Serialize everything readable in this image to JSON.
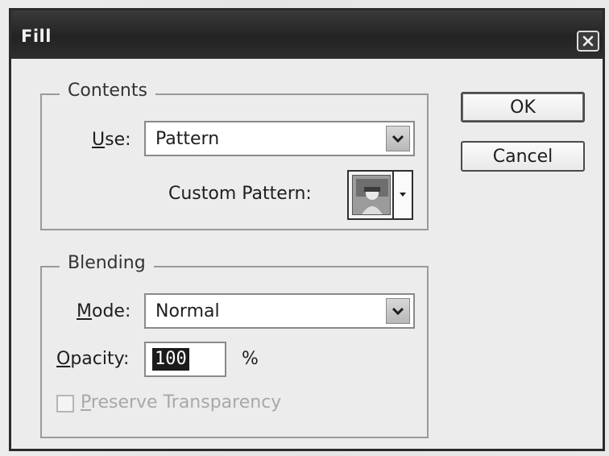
{
  "window": {
    "title": "Fill",
    "close_icon": "close-icon"
  },
  "contents": {
    "label": "Contents",
    "use_label_accel": "U",
    "use_label_rest": "se:",
    "use_value": "Pattern",
    "custom_pattern_label": "Custom Pattern:"
  },
  "blending": {
    "label": "Blending",
    "mode_label_accel": "M",
    "mode_label_rest": "ode:",
    "mode_value": "Normal",
    "opacity_label_accel": "O",
    "opacity_label_rest": "pacity:",
    "opacity_value": "100",
    "opacity_unit": "%",
    "preserve_label_accel": "P",
    "preserve_label_rest": "reserve Transparency",
    "preserve_checked": false,
    "preserve_enabled": false
  },
  "buttons": {
    "ok": "OK",
    "cancel": "Cancel"
  },
  "colors": {
    "titlebar": "#2b2b2b",
    "dialog_bg": "#ececec",
    "selection": "#1b1b1b"
  }
}
